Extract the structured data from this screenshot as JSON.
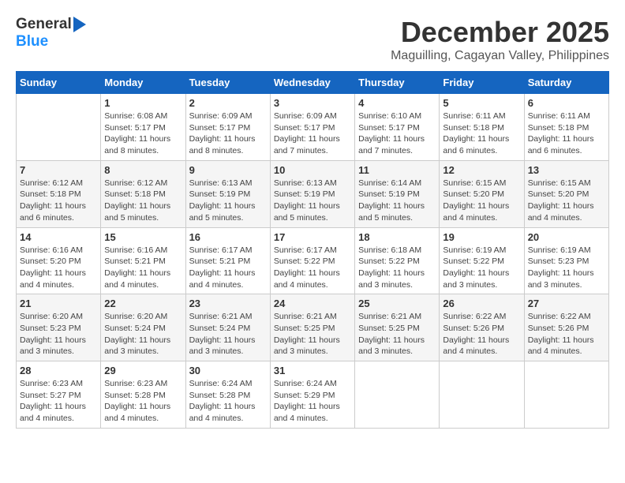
{
  "header": {
    "logo_line1": "General",
    "logo_line2": "Blue",
    "month_title": "December 2025",
    "location": "Maguilling, Cagayan Valley, Philippines"
  },
  "days_of_week": [
    "Sunday",
    "Monday",
    "Tuesday",
    "Wednesday",
    "Thursday",
    "Friday",
    "Saturday"
  ],
  "weeks": [
    [
      {
        "day": "",
        "info": ""
      },
      {
        "day": "1",
        "info": "Sunrise: 6:08 AM\nSunset: 5:17 PM\nDaylight: 11 hours\nand 8 minutes."
      },
      {
        "day": "2",
        "info": "Sunrise: 6:09 AM\nSunset: 5:17 PM\nDaylight: 11 hours\nand 8 minutes."
      },
      {
        "day": "3",
        "info": "Sunrise: 6:09 AM\nSunset: 5:17 PM\nDaylight: 11 hours\nand 7 minutes."
      },
      {
        "day": "4",
        "info": "Sunrise: 6:10 AM\nSunset: 5:17 PM\nDaylight: 11 hours\nand 7 minutes."
      },
      {
        "day": "5",
        "info": "Sunrise: 6:11 AM\nSunset: 5:18 PM\nDaylight: 11 hours\nand 6 minutes."
      },
      {
        "day": "6",
        "info": "Sunrise: 6:11 AM\nSunset: 5:18 PM\nDaylight: 11 hours\nand 6 minutes."
      }
    ],
    [
      {
        "day": "7",
        "info": "Sunrise: 6:12 AM\nSunset: 5:18 PM\nDaylight: 11 hours\nand 6 minutes."
      },
      {
        "day": "8",
        "info": "Sunrise: 6:12 AM\nSunset: 5:18 PM\nDaylight: 11 hours\nand 5 minutes."
      },
      {
        "day": "9",
        "info": "Sunrise: 6:13 AM\nSunset: 5:19 PM\nDaylight: 11 hours\nand 5 minutes."
      },
      {
        "day": "10",
        "info": "Sunrise: 6:13 AM\nSunset: 5:19 PM\nDaylight: 11 hours\nand 5 minutes."
      },
      {
        "day": "11",
        "info": "Sunrise: 6:14 AM\nSunset: 5:19 PM\nDaylight: 11 hours\nand 5 minutes."
      },
      {
        "day": "12",
        "info": "Sunrise: 6:15 AM\nSunset: 5:20 PM\nDaylight: 11 hours\nand 4 minutes."
      },
      {
        "day": "13",
        "info": "Sunrise: 6:15 AM\nSunset: 5:20 PM\nDaylight: 11 hours\nand 4 minutes."
      }
    ],
    [
      {
        "day": "14",
        "info": "Sunrise: 6:16 AM\nSunset: 5:20 PM\nDaylight: 11 hours\nand 4 minutes."
      },
      {
        "day": "15",
        "info": "Sunrise: 6:16 AM\nSunset: 5:21 PM\nDaylight: 11 hours\nand 4 minutes."
      },
      {
        "day": "16",
        "info": "Sunrise: 6:17 AM\nSunset: 5:21 PM\nDaylight: 11 hours\nand 4 minutes."
      },
      {
        "day": "17",
        "info": "Sunrise: 6:17 AM\nSunset: 5:22 PM\nDaylight: 11 hours\nand 4 minutes."
      },
      {
        "day": "18",
        "info": "Sunrise: 6:18 AM\nSunset: 5:22 PM\nDaylight: 11 hours\nand 3 minutes."
      },
      {
        "day": "19",
        "info": "Sunrise: 6:19 AM\nSunset: 5:22 PM\nDaylight: 11 hours\nand 3 minutes."
      },
      {
        "day": "20",
        "info": "Sunrise: 6:19 AM\nSunset: 5:23 PM\nDaylight: 11 hours\nand 3 minutes."
      }
    ],
    [
      {
        "day": "21",
        "info": "Sunrise: 6:20 AM\nSunset: 5:23 PM\nDaylight: 11 hours\nand 3 minutes."
      },
      {
        "day": "22",
        "info": "Sunrise: 6:20 AM\nSunset: 5:24 PM\nDaylight: 11 hours\nand 3 minutes."
      },
      {
        "day": "23",
        "info": "Sunrise: 6:21 AM\nSunset: 5:24 PM\nDaylight: 11 hours\nand 3 minutes."
      },
      {
        "day": "24",
        "info": "Sunrise: 6:21 AM\nSunset: 5:25 PM\nDaylight: 11 hours\nand 3 minutes."
      },
      {
        "day": "25",
        "info": "Sunrise: 6:21 AM\nSunset: 5:25 PM\nDaylight: 11 hours\nand 3 minutes."
      },
      {
        "day": "26",
        "info": "Sunrise: 6:22 AM\nSunset: 5:26 PM\nDaylight: 11 hours\nand 4 minutes."
      },
      {
        "day": "27",
        "info": "Sunrise: 6:22 AM\nSunset: 5:26 PM\nDaylight: 11 hours\nand 4 minutes."
      }
    ],
    [
      {
        "day": "28",
        "info": "Sunrise: 6:23 AM\nSunset: 5:27 PM\nDaylight: 11 hours\nand 4 minutes."
      },
      {
        "day": "29",
        "info": "Sunrise: 6:23 AM\nSunset: 5:28 PM\nDaylight: 11 hours\nand 4 minutes."
      },
      {
        "day": "30",
        "info": "Sunrise: 6:24 AM\nSunset: 5:28 PM\nDaylight: 11 hours\nand 4 minutes."
      },
      {
        "day": "31",
        "info": "Sunrise: 6:24 AM\nSunset: 5:29 PM\nDaylight: 11 hours\nand 4 minutes."
      },
      {
        "day": "",
        "info": ""
      },
      {
        "day": "",
        "info": ""
      },
      {
        "day": "",
        "info": ""
      }
    ]
  ]
}
